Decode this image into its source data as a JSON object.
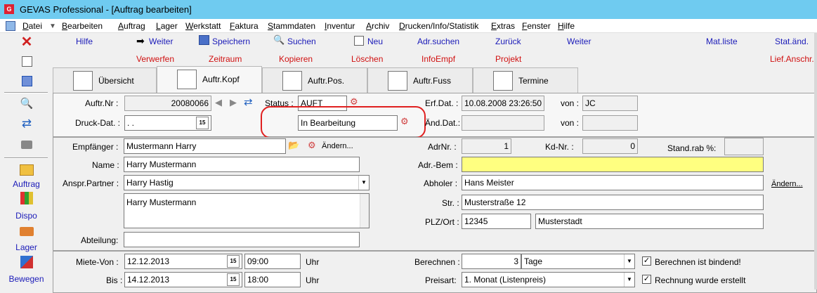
{
  "window": {
    "title": "GEVAS Professional - [Auftrag bearbeiten]"
  },
  "menu": [
    "Datei",
    "Bearbeiten",
    "Auftrag",
    "Lager",
    "Werkstatt",
    "Faktura",
    "Stammdaten",
    "Inventur",
    "Archiv",
    "Drucken/Info/Statistik",
    "Extras",
    "Fenster",
    "Hilfe"
  ],
  "toolbar": {
    "row1": {
      "hilfe": "Hilfe",
      "weiter1": "Weiter",
      "speichern": "Speichern",
      "suchen": "Suchen",
      "neu": "Neu",
      "adrsuchen": "Adr.suchen",
      "zurueck": "Zurück",
      "weiter2": "Weiter",
      "matliste": "Mat.liste",
      "statand": "Stat.änd."
    },
    "row2": {
      "verwerfen": "Verwerfen",
      "zeitraum": "Zeitraum",
      "kopieren": "Kopieren",
      "loeschen": "Löschen",
      "infoempf": "InfoEmpf",
      "projekt": "Projekt",
      "liefanschr": "Lief.Anschr."
    }
  },
  "leftbar": {
    "auftrag": "Auftrag",
    "dispo": "Dispo",
    "lager": "Lager",
    "bewegen": "Bewegen"
  },
  "tabs": [
    "Übersicht",
    "Auftr.Kopf",
    "Auftr.Pos.",
    "Auftr.Fuss",
    "Termine"
  ],
  "header": {
    "auftrnr_label": "Auftr.Nr :",
    "auftrnr": "20080066",
    "status_label": "Status :",
    "status": "AUFT",
    "status_text": "In Bearbeitung",
    "erfdat_label": "Erf.Dat. :",
    "erfdat": "10.08.2008 23:26:50",
    "von_label": "von :",
    "von1": "JC",
    "druckdat_label": "Druck-Dat. :",
    "druckdat": ". .",
    "anddat_label": "Änd.Dat.:",
    "anddat": "",
    "von2_label": "von :",
    "von2": ""
  },
  "address": {
    "empfaenger_label": "Empfänger :",
    "empfaenger": "Mustermann Harry",
    "aendern1": "Ändern...",
    "name_label": "Name :",
    "name": "Harry Mustermann",
    "anspr_label": "Anspr.Partner :",
    "anspr": "Harry Hastig",
    "memo": "Harry Mustermann",
    "abteilung_label": "Abteilung:",
    "abteilung": "",
    "adrnr_label": "AdrNr. :",
    "adrnr": "1",
    "kdnr_label": "Kd-Nr. :",
    "kdnr": "0",
    "standrab_label": "Stand.rab %:",
    "standrab": "",
    "adrbem_label": "Adr.-Bem :",
    "adrbem": "",
    "abholer_label": "Abholer :",
    "abholer": "Hans Meister",
    "aendern2": "Ändern...",
    "str_label": "Str. :",
    "str": "Musterstraße 12",
    "plz_label": "PLZ/Ort :",
    "plz": "12345",
    "ort": "Musterstadt"
  },
  "rental": {
    "mietevon_label": "Miete-Von :",
    "mietevon_date": "12.12.2013",
    "mietevon_time": "09:00",
    "uhr1": "Uhr",
    "bis_label": "Bis :",
    "bis_date": "14.12.2013",
    "bis_time": "18:00",
    "uhr2": "Uhr",
    "berechnen_label": "Berechnen :",
    "berechnen_value": "3",
    "berechnen_unit": "Tage",
    "preisart_label": "Preisart:",
    "preisart": "1. Monat (Listenpreis)",
    "chk1_label": "Berechnen ist bindend!",
    "chk2_label": "Rechnung wurde erstellt"
  },
  "colors": {
    "titlebar": "#6fcbf0",
    "link": "#1a1ab8",
    "danger": "#d01010",
    "highlight": "#ffff80",
    "annotation": "#e02020"
  }
}
